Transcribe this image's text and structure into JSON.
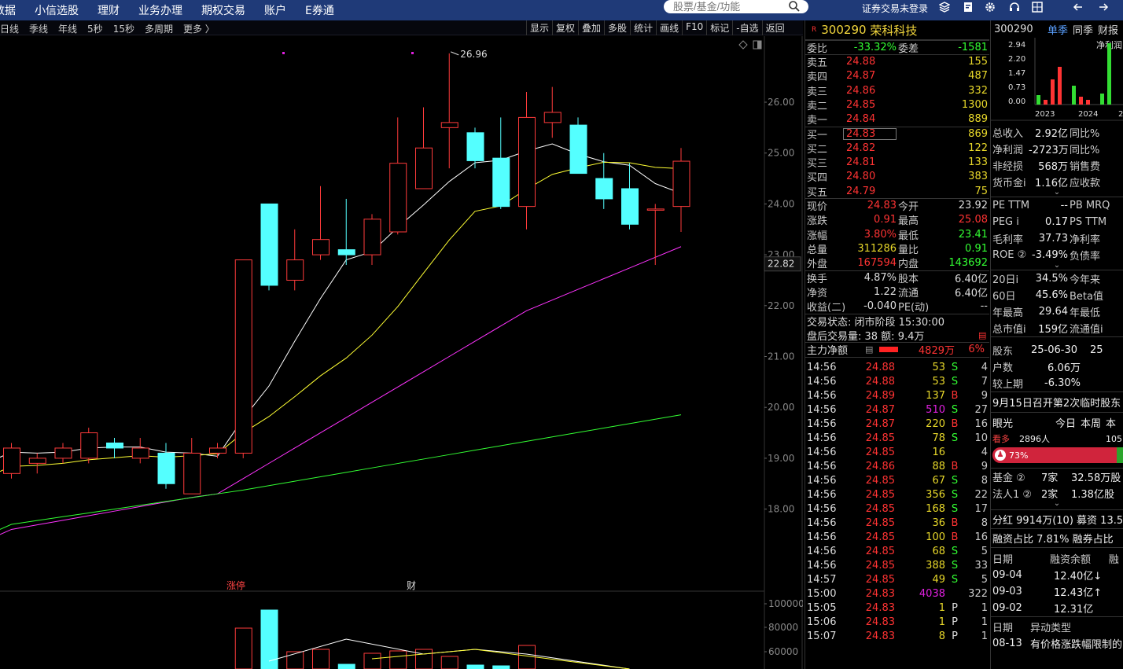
{
  "topbar": {
    "menu": [
      "数据",
      "小信选股",
      "理财",
      "业务办理",
      "期权交易",
      "账户",
      "E券通"
    ],
    "search_placeholder": "股票/基金/功能",
    "login_status": "证券交易未登录"
  },
  "chart_toolbar": {
    "periods": [
      "日线",
      "季线",
      "年线",
      "5秒",
      "15秒",
      "多周期",
      "更多 〉"
    ],
    "tools": [
      "显示",
      "复权",
      "叠加",
      "多股",
      "统计",
      "画线",
      "F10",
      "标记",
      "-自选",
      "返回"
    ]
  },
  "chart": {
    "high_label": "26.96",
    "price_axis": [
      "26.00",
      "25.00",
      "24.00",
      "23.00",
      "22.00",
      "21.00",
      "20.00",
      "19.00",
      "18.00"
    ],
    "current_price": "22.82",
    "event_labels": [
      "涨停",
      "财"
    ],
    "vol_axis": [
      "100000",
      "80000",
      "60000"
    ],
    "colors": {
      "up": "#ff3b3b",
      "down": "#54ffff",
      "ma5": "#ffffff",
      "ma10": "#ffff33",
      "ma20": "#ff33ff",
      "ma60": "#33ff33"
    }
  },
  "chart_data": {
    "type": "candlestick",
    "candles": [
      {
        "o": 18.7,
        "h": 19.3,
        "l": 18.6,
        "c": 19.2
      },
      {
        "o": 18.9,
        "h": 19.1,
        "l": 18.7,
        "c": 19.0
      },
      {
        "o": 19.0,
        "h": 19.3,
        "l": 18.9,
        "c": 19.2
      },
      {
        "o": 19.0,
        "h": 19.6,
        "l": 18.9,
        "c": 19.5
      },
      {
        "o": 19.3,
        "h": 19.4,
        "l": 19.0,
        "c": 19.2
      },
      {
        "o": 19.0,
        "h": 19.4,
        "l": 18.9,
        "c": 19.2
      },
      {
        "o": 19.1,
        "h": 19.3,
        "l": 18.4,
        "c": 18.5
      },
      {
        "o": 18.3,
        "h": 19.4,
        "l": 18.3,
        "c": 19.1
      },
      {
        "o": 19.1,
        "h": 19.3,
        "l": 19.0,
        "c": 19.2
      },
      {
        "o": 19.1,
        "h": 22.9,
        "l": 19.0,
        "c": 22.9
      },
      {
        "o": 24.0,
        "h": 24.0,
        "l": 22.3,
        "c": 22.4
      },
      {
        "o": 22.5,
        "h": 23.5,
        "l": 22.3,
        "c": 22.9
      },
      {
        "o": 23.0,
        "h": 24.35,
        "l": 22.9,
        "c": 23.3
      },
      {
        "o": 23.1,
        "h": 24.1,
        "l": 22.8,
        "c": 23.0
      },
      {
        "o": 23.0,
        "h": 23.8,
        "l": 22.8,
        "c": 23.7
      },
      {
        "o": 23.45,
        "h": 25.7,
        "l": 23.4,
        "c": 24.8
      },
      {
        "o": 24.3,
        "h": 25.9,
        "l": 24.3,
        "c": 25.1
      },
      {
        "o": 25.5,
        "h": 26.96,
        "l": 24.7,
        "c": 25.6
      },
      {
        "o": 25.4,
        "h": 25.5,
        "l": 24.7,
        "c": 24.85
      },
      {
        "o": 24.9,
        "h": 25.7,
        "l": 23.9,
        "c": 23.95
      },
      {
        "o": 23.95,
        "h": 26.2,
        "l": 23.5,
        "c": 25.7
      },
      {
        "o": 25.6,
        "h": 26.3,
        "l": 25.3,
        "c": 25.8
      },
      {
        "o": 25.55,
        "h": 25.7,
        "l": 24.6,
        "c": 24.6
      },
      {
        "o": 24.5,
        "h": 25.0,
        "l": 23.9,
        "c": 24.1
      },
      {
        "o": 24.3,
        "h": 24.8,
        "l": 23.5,
        "c": 23.6
      },
      {
        "o": 23.9,
        "h": 24.0,
        "l": 22.8,
        "c": 23.9
      },
      {
        "o": 23.95,
        "h": 25.1,
        "l": 23.45,
        "c": 24.84
      }
    ]
  },
  "quote": {
    "code": "300290",
    "name": "荣科科技",
    "webi": {
      "label": "委比",
      "value": "-33.32%",
      "label2": "委差",
      "value2": "-1581"
    },
    "asks": [
      {
        "label": "卖五",
        "price": "24.88",
        "vol": "155"
      },
      {
        "label": "卖四",
        "price": "24.87",
        "vol": "487"
      },
      {
        "label": "卖三",
        "price": "24.86",
        "vol": "332"
      },
      {
        "label": "卖二",
        "price": "24.85",
        "vol": "1300"
      },
      {
        "label": "卖一",
        "price": "24.84",
        "vol": "889"
      }
    ],
    "bids": [
      {
        "label": "买一",
        "price": "24.83",
        "vol": "869"
      },
      {
        "label": "买二",
        "price": "24.82",
        "vol": "122"
      },
      {
        "label": "买三",
        "price": "24.81",
        "vol": "133"
      },
      {
        "label": "买四",
        "price": "24.80",
        "vol": "383"
      },
      {
        "label": "买五",
        "price": "24.79",
        "vol": "75"
      }
    ],
    "stats": [
      {
        "l": "现价",
        "v": "24.83",
        "vc": "red",
        "l2": "今开",
        "v2": "23.92",
        "v2c": "white"
      },
      {
        "l": "涨跌",
        "v": "0.91",
        "vc": "red",
        "l2": "最高",
        "v2": "25.08",
        "v2c": "red"
      },
      {
        "l": "涨幅",
        "v": "3.80%",
        "vc": "red",
        "l2": "最低",
        "v2": "23.41",
        "v2c": "green"
      },
      {
        "l": "总量",
        "v": "311286",
        "vc": "yellow",
        "l2": "量比",
        "v2": "0.91",
        "v2c": "green"
      },
      {
        "l": "外盘",
        "v": "167594",
        "vc": "red",
        "l2": "内盘",
        "v2": "143692",
        "v2c": "green"
      }
    ],
    "stats2": [
      {
        "l": "换手",
        "v": "4.87%",
        "l2": "股本",
        "v2": "6.40亿"
      },
      {
        "l": "净资",
        "v": "1.22",
        "l2": "流通",
        "v2": "6.40亿"
      },
      {
        "l": "收益(二)",
        "v": "-0.040",
        "l2": "PE(动)",
        "v2": "--"
      }
    ],
    "status": "交易状态: 闭市阶段 15:30:00",
    "after_hours": "盘后交易量: 38  额: 9.4万",
    "main_flow": {
      "label": "主力净额",
      "value": "4829万",
      "pct": "6%"
    },
    "ticks": [
      [
        "14:56",
        "24.88",
        "53",
        "S",
        "4"
      ],
      [
        "14:56",
        "24.88",
        "53",
        "S",
        "7"
      ],
      [
        "14:56",
        "24.89",
        "137",
        "B",
        "9"
      ],
      [
        "14:56",
        "24.87",
        "510",
        "S",
        "27"
      ],
      [
        "14:56",
        "24.87",
        "220",
        "B",
        "16"
      ],
      [
        "14:56",
        "24.85",
        "78",
        "S",
        "10"
      ],
      [
        "14:56",
        "24.85",
        "16",
        "",
        "4"
      ],
      [
        "14:56",
        "24.86",
        "88",
        "B",
        "9"
      ],
      [
        "14:56",
        "24.85",
        "67",
        "S",
        "8"
      ],
      [
        "14:56",
        "24.85",
        "356",
        "S",
        "22"
      ],
      [
        "14:56",
        "24.85",
        "168",
        "S",
        "17"
      ],
      [
        "14:56",
        "24.85",
        "36",
        "B",
        "8"
      ],
      [
        "14:56",
        "24.85",
        "100",
        "B",
        "16"
      ],
      [
        "14:56",
        "24.85",
        "68",
        "S",
        "5"
      ],
      [
        "14:56",
        "24.85",
        "388",
        "S",
        "33"
      ],
      [
        "14:57",
        "24.85",
        "49",
        "S",
        "5"
      ],
      [
        "15:00",
        "24.83",
        "4038",
        "",
        "322"
      ],
      [
        "15:05",
        "24.83",
        "1",
        "P",
        "1"
      ],
      [
        "15:06",
        "24.83",
        "1",
        "P",
        "1"
      ],
      [
        "15:07",
        "24.83",
        "8",
        "P",
        "1"
      ]
    ]
  },
  "fin": {
    "code": "300290",
    "tabs": [
      "单季",
      "同季",
      "财报"
    ],
    "bar_axis": [
      "2.94",
      "2.20",
      "1.47",
      "0.73",
      "0.00"
    ],
    "legend": "净利润",
    "years": [
      "2023",
      "2024",
      "2"
    ],
    "bars": [
      0.3,
      0.15,
      1.0,
      1.7,
      0,
      0.8,
      0.35,
      0.2,
      0,
      0.6,
      2.94
    ],
    "rows": [
      {
        "l": "总收入",
        "v": "2.92亿",
        "l2": "同比%"
      },
      {
        "l": "净利润",
        "v": "-2723万",
        "l2": "同比%"
      },
      {
        "l": "非经损",
        "v": "568万",
        "l2": "销售费"
      },
      {
        "l": "货币金i",
        "v": "1.16亿",
        "l2": "应收款"
      }
    ],
    "rows2": [
      {
        "l": "PE TTM",
        "v": "--",
        "l2": "PB MRQ"
      },
      {
        "l": "PEG i",
        "v": "0.17",
        "l2": "PS TTM"
      },
      {
        "l": "毛利率",
        "v": "37.73",
        "l2": "净利率"
      },
      {
        "l": "ROE ②",
        "v": "-3.49%",
        "l2": "负债率"
      }
    ],
    "rows3": [
      {
        "l": "20日i",
        "v": "34.5%",
        "l2": "今年来"
      },
      {
        "l": "60日",
        "v": "45.6%",
        "l2": "Beta值"
      },
      {
        "l": "年最高",
        "v": "29.64",
        "l2": "年最低"
      },
      {
        "l": "总市值i",
        "v": "159亿",
        "l2": "流通值i"
      }
    ],
    "holders": {
      "l": "股东",
      "date": "25-06-30",
      "extra": "25",
      "hu_l": "户数",
      "hu": "6.06万",
      "cmp_l": "较上期",
      "cmp": "-6.30%"
    },
    "news": "9月15日召开第2次临时股东",
    "eyes": {
      "l": "眼光",
      "tabs": [
        "今日",
        "本周",
        "本"
      ],
      "bull": "看多",
      "count": "2896人",
      "extra": "105",
      "pct": "73%"
    },
    "inst": [
      {
        "l": "基金 ②",
        "v": "7家",
        "v2": "32.58万股"
      },
      {
        "l": "法人1 ②",
        "v": "2家",
        "v2": "1.38亿股"
      }
    ],
    "div": "分红 9914万(10) 募资 13.5",
    "margin": "融资占比  7.81% 融券占比",
    "margin_table": {
      "h": [
        "日期",
        "融资余额",
        "融"
      ],
      "rows": [
        [
          "09-04",
          "12.40亿↓"
        ],
        [
          "09-03",
          "12.43亿↑"
        ],
        [
          "09-02",
          "12.31亿"
        ]
      ]
    },
    "abn": {
      "h": [
        "日期",
        "异动类型"
      ],
      "rows": [
        [
          "08-13",
          "有价格涨跌幅限制的"
        ]
      ]
    }
  }
}
